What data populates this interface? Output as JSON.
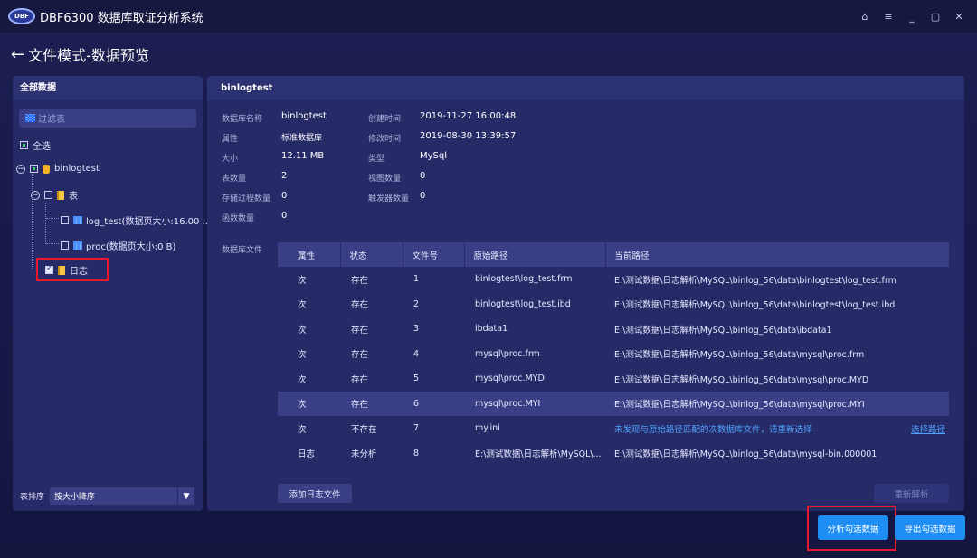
{
  "app": {
    "logo_text": "DBF",
    "title": "DBF6300 数据库取证分析系统"
  },
  "window_controls": [
    "⌂",
    "≡",
    "_",
    "▢",
    "✕"
  ],
  "page": {
    "back_arrow": "←",
    "title": "文件模式-数据预览"
  },
  "left_panel": {
    "header": "全部数据",
    "filter_placeholder": "过滤表",
    "select_all": "全选",
    "tree": {
      "db_name": "binlogtest",
      "tables_node": "表",
      "tables": [
        "log_test(数据页大小:16.00 ...",
        "proc(数据页大小:0 B)"
      ],
      "log_node": "日志"
    },
    "sort_label": "表排序",
    "sort_value": "按大小降序"
  },
  "right_panel": {
    "header": "binlogtest",
    "info": {
      "db_name_label": "数据库名称",
      "db_name": "binlogtest",
      "created_label": "创建时间",
      "created": "2019-11-27 16:00:48",
      "attr_label": "属性",
      "attr": "标准数据库",
      "modified_label": "修改时间",
      "modified": "2019-08-30 13:39:57",
      "size_label": "大小",
      "size": "12.11 MB",
      "type_label": "类型",
      "type": "MySql",
      "table_count_label": "表数量",
      "table_count": "2",
      "view_count_label": "视图数量",
      "view_count": "0",
      "proc_count_label": "存储过程数量",
      "proc_count": "0",
      "trigger_count_label": "触发器数量",
      "trigger_count": "0",
      "func_count_label": "函数数量",
      "func_count": "0"
    },
    "files_label": "数据库文件",
    "columns": [
      "属性",
      "状态",
      "文件号",
      "原始路径",
      "当前路径"
    ],
    "rows": [
      {
        "attr": "次",
        "status": "存在",
        "no": "1",
        "orig": "binlogtest\\log_test.frm",
        "cur": "E:\\测试数据\\日志解析\\MySQL\\binlog_56\\data\\binlogtest\\log_test.frm"
      },
      {
        "attr": "次",
        "status": "存在",
        "no": "2",
        "orig": "binlogtest\\log_test.ibd",
        "cur": "E:\\测试数据\\日志解析\\MySQL\\binlog_56\\data\\binlogtest\\log_test.ibd"
      },
      {
        "attr": "次",
        "status": "存在",
        "no": "3",
        "orig": "ibdata1",
        "cur": "E:\\测试数据\\日志解析\\MySQL\\binlog_56\\data\\ibdata1"
      },
      {
        "attr": "次",
        "status": "存在",
        "no": "4",
        "orig": "mysql\\proc.frm",
        "cur": "E:\\测试数据\\日志解析\\MySQL\\binlog_56\\data\\mysql\\proc.frm"
      },
      {
        "attr": "次",
        "status": "存在",
        "no": "5",
        "orig": "mysql\\proc.MYD",
        "cur": "E:\\测试数据\\日志解析\\MySQL\\binlog_56\\data\\mysql\\proc.MYD"
      },
      {
        "attr": "次",
        "status": "存在",
        "no": "6",
        "orig": "mysql\\proc.MYI",
        "cur": "E:\\测试数据\\日志解析\\MySQL\\binlog_56\\data\\mysql\\proc.MYI"
      },
      {
        "attr": "次",
        "status": "不存在",
        "no": "7",
        "orig": "my.ini",
        "cur": "未发现与原始路径匹配的次数据库文件，请重新选择",
        "cur_link": "选择路径"
      },
      {
        "attr": "日志",
        "status": "未分析",
        "no": "8",
        "orig": "E:\\测试数据\\日志解析\\MySQL\\...",
        "cur": "E:\\测试数据\\日志解析\\MySQL\\binlog_56\\data\\mysql-bin.000001"
      }
    ],
    "add_log_button": "添加日志文件",
    "reparse_button": "重新解析"
  },
  "footer": {
    "analyze_button": "分析勾选数据",
    "export_button": "导出勾选数据"
  },
  "colors": {
    "accent": "#1f8ef4",
    "highlight": "#e8192c",
    "link": "#4fa3ff"
  }
}
